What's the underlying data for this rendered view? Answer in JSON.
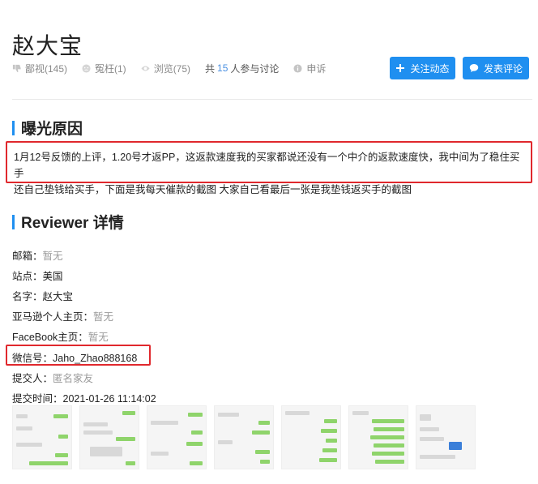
{
  "page_title": "赵大宝",
  "stats": {
    "expose_label": "鄙视(145)",
    "unjust_label": "冤枉(1)",
    "views_label": "浏览(75)",
    "discuss_prefix": "共",
    "discuss_count": "15",
    "discuss_suffix": "人参与讨论",
    "appeal_label": "申诉"
  },
  "buttons": {
    "follow_label": "关注动态",
    "comment_label": "发表评论"
  },
  "reason_section": {
    "title": "曝光原因",
    "text_line1": "1月12号反馈的上评，1.20号才返PP，这返款速度我的买家都说还没有一个中介的返款速度快，我中间为了稳住买手",
    "text_line2": "还自己垫钱给买手，下面是我每天催款的截图 大家自己看最后一张是我垫钱返买手的截图"
  },
  "reviewer_section": {
    "title": "Reviewer 详情",
    "email_label": "邮箱：",
    "email_value": "暂无",
    "site_label": "站点：",
    "site_value": "美国",
    "name_label": "名字：",
    "name_value": "赵大宝",
    "amazon_label": "亚马逊个人主页：",
    "amazon_value": "暂无",
    "facebook_label": "FaceBook主页：",
    "facebook_value": "暂无",
    "wechat_label": "微信号：",
    "wechat_value": "Jaho_Zhao888168",
    "submitter_label": "提交人：",
    "submitter_value": "匿名家友",
    "submit_time_label": "提交时间：",
    "submit_time_value": "2021-01-26 11:14:02"
  },
  "screenshot_count": 7,
  "colors": {
    "accent": "#1f8ff0",
    "highlight_border": "#e0282d",
    "chat_green": "#8fd46b"
  }
}
